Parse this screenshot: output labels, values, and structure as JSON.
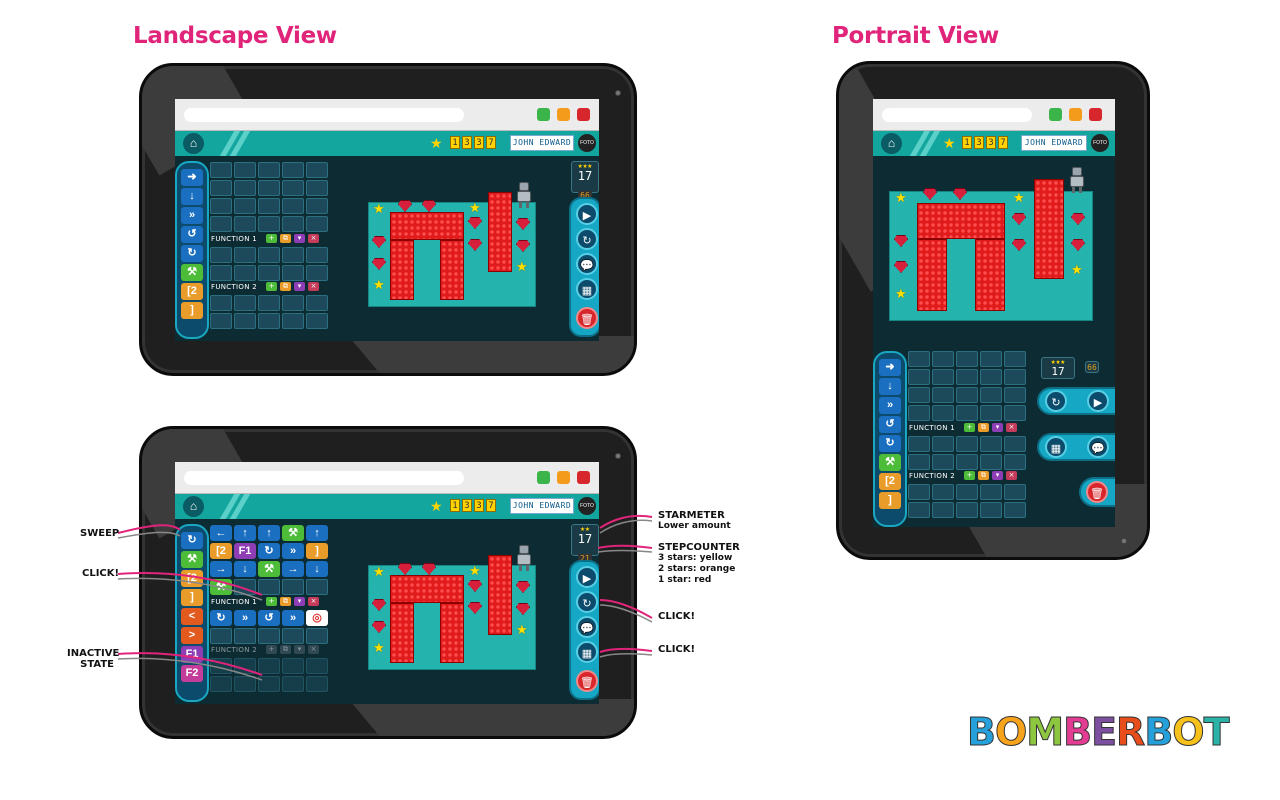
{
  "headings": {
    "landscape": "Landscape View",
    "portrait": "Portrait View"
  },
  "app": {
    "score_digits": [
      "1",
      "3",
      "3",
      "7"
    ],
    "user_name": "JOHN EDWARD",
    "photo_label": "FOTO",
    "home_icon": "home-icon"
  },
  "functions": {
    "f1_label": "FUNCTION 1",
    "f2_label": "FUNCTION 2"
  },
  "meter": {
    "steps": "17",
    "limit_1": "66",
    "limit_2": "21",
    "limit_3": "66"
  },
  "annotations": {
    "sweep": "SWEEP",
    "click_left": "CLICK!",
    "inactive": "INACTIVE\nSTATE",
    "starmeter_title": "STARMETER",
    "starmeter_sub": "Lower amount",
    "stepcounter_title": "STEPCOUNTER",
    "stepcounter_l1": "3 stars: yellow",
    "stepcounter_l2": "2 stars: orange",
    "stepcounter_l3": "1 star: red",
    "click_right_1": "CLICK!",
    "click_right_2": "CLICK!"
  },
  "program_tiles": {
    "row1": [
      "←",
      "↑",
      "↑",
      "⚒",
      "↑"
    ],
    "row2": [
      "[2",
      "F1",
      "↻",
      "»",
      "]"
    ],
    "row3": [
      "→",
      "↓",
      "⚒",
      "→",
      "↓"
    ],
    "row5": [
      "↻",
      "»",
      "↺",
      "»",
      "◎"
    ],
    "f1_label_in": "F1"
  },
  "logo": {
    "letters": [
      "B",
      "O",
      "M",
      "B",
      "E",
      "R",
      "B",
      "O",
      "T"
    ],
    "colors": [
      "#26a0da",
      "#f7a31b",
      "#8dc63f",
      "#e23d92",
      "#7d4fa0",
      "#e84e1b",
      "#26a0da",
      "#f7c11b",
      "#2bb3a8"
    ]
  },
  "colors": {
    "accent": "#e0247a",
    "teal": "#13a69f",
    "panel": "#15a7c3"
  }
}
